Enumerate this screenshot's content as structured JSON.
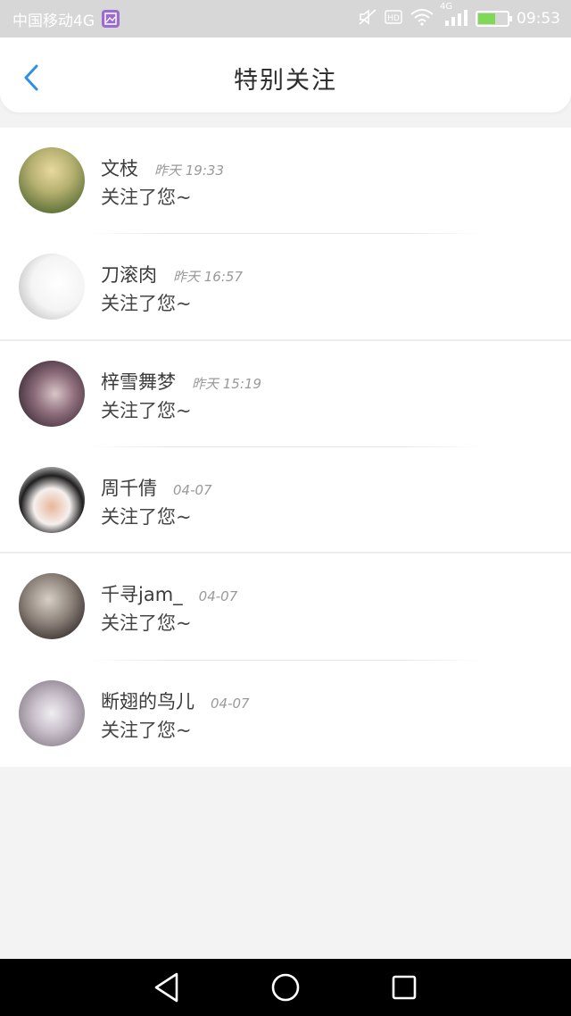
{
  "status_bar": {
    "carrier": "中国移动4G",
    "network": "4G",
    "time": "09:53",
    "battery_level": 0.55,
    "icons": [
      "gallery-icon",
      "mute-icon",
      "hd-icon",
      "wifi-icon",
      "signal-icon",
      "battery-icon"
    ]
  },
  "header": {
    "title": "特别关注",
    "back_icon": "chevron-left-icon",
    "accent": "#2f8fe8"
  },
  "list": {
    "items": [
      {
        "name": "文枝",
        "time": "昨天 19:33",
        "message": "关注了您~",
        "avatar_colors": [
          "#e9d9a0",
          "#8a9a5b",
          "#3e5a32"
        ]
      },
      {
        "name": "刀滚肉",
        "time": "昨天 16:57",
        "message": "关注了您~",
        "avatar_colors": [
          "#ffffff",
          "#c9c9c9",
          "#7a5a3a"
        ]
      },
      {
        "name": "梓雪舞梦",
        "time": "昨天 15:19",
        "message": "关注了您~",
        "avatar_colors": [
          "#3a2a35",
          "#8f6f7c",
          "#d9c6c9"
        ]
      },
      {
        "name": "周千倩",
        "time": "04-07",
        "message": "关注了您~",
        "avatar_colors": [
          "#ffffff",
          "#1f1f1f",
          "#e8b79a"
        ]
      },
      {
        "name": "千寻jam_",
        "time": "04-07",
        "message": "关注了您~",
        "avatar_colors": [
          "#2a2020",
          "#8a8078",
          "#d8d0c8"
        ]
      },
      {
        "name": "断翅的鸟儿",
        "time": "04-07",
        "message": "关注了您~",
        "avatar_colors": [
          "#f2eef2",
          "#9d94a0",
          "#55505a"
        ]
      }
    ]
  },
  "nav_bar": {
    "back": "triangle-back-icon",
    "home": "circle-home-icon",
    "recents": "square-recents-icon"
  }
}
